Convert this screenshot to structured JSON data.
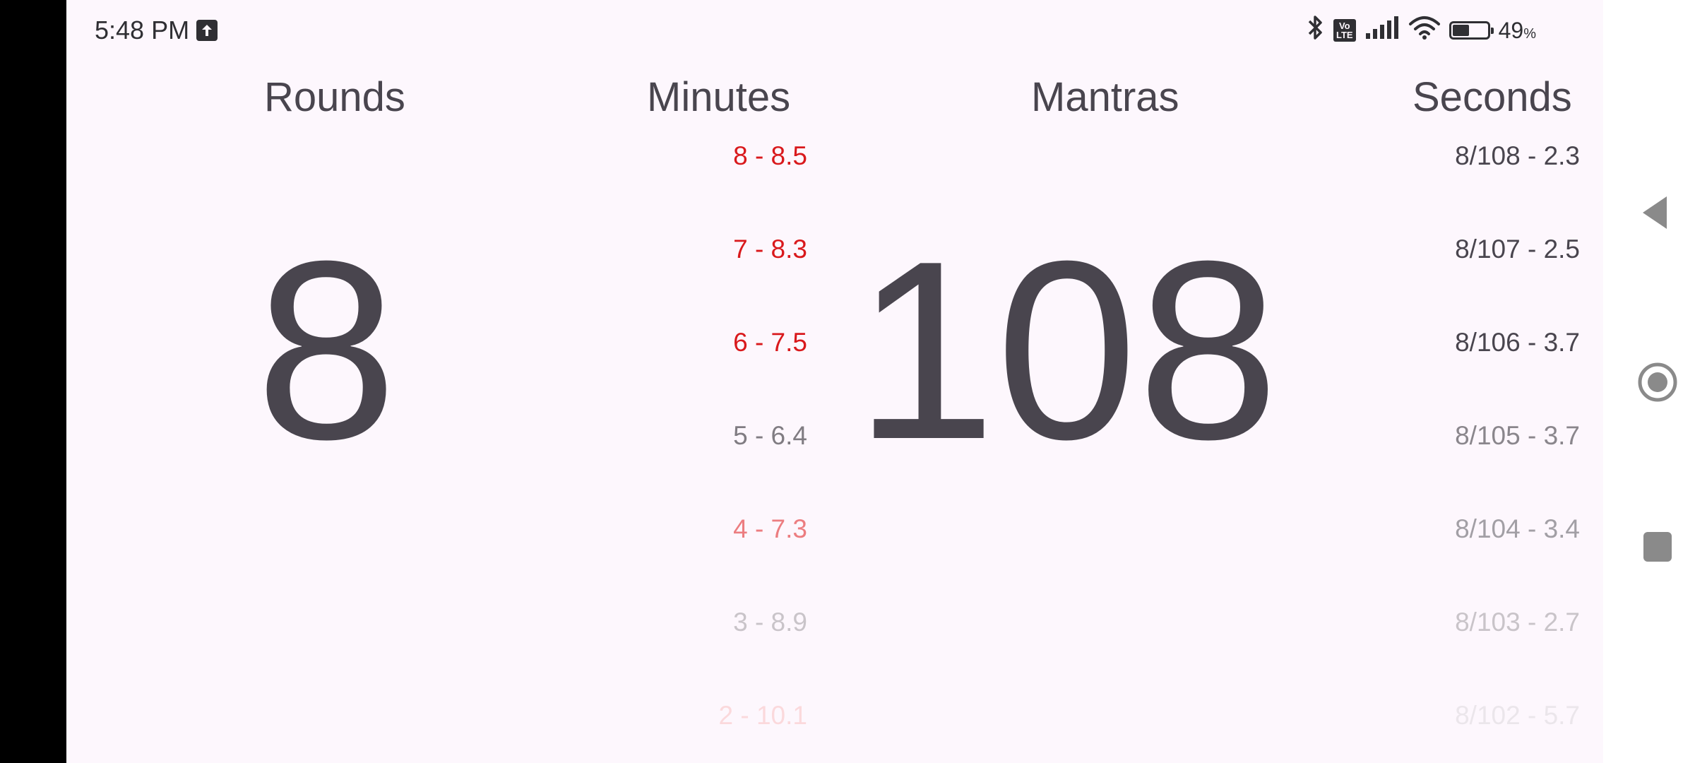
{
  "status_bar": {
    "time": "5:48 PM",
    "battery_level": 0.49,
    "battery_text": "49",
    "battery_unit": "%",
    "volte_top": "Vo",
    "volte_bottom": "LTE"
  },
  "headers": {
    "rounds": "Rounds",
    "minutes": "Minutes",
    "mantras": "Mantras",
    "seconds": "Seconds"
  },
  "counters": {
    "rounds": "8",
    "mantras": "108"
  },
  "minutes_list": [
    {
      "text": "8 - 8.5",
      "color": "#d9191c"
    },
    {
      "text": "7 - 8.3",
      "color": "#d9191c"
    },
    {
      "text": "6 - 7.5",
      "color": "#d9191c"
    },
    {
      "text": "5 - 6.4",
      "color": "#807c82"
    },
    {
      "text": "4 - 7.3",
      "color": "#ec7d80"
    },
    {
      "text": "3 - 8.9",
      "color": "#c9c4c9"
    },
    {
      "text": "2 - 10.1",
      "color": "#fbd9dc"
    }
  ],
  "seconds_list": [
    {
      "text": "8/108 - 2.3",
      "color": "#49454e"
    },
    {
      "text": "8/107 - 2.5",
      "color": "#49454e"
    },
    {
      "text": "8/106 - 3.7",
      "color": "#49454e"
    },
    {
      "text": "8/105 - 3.7",
      "color": "#8a868c"
    },
    {
      "text": "8/104 - 3.4",
      "color": "#a29fa5"
    },
    {
      "text": "8/103 - 2.7",
      "color": "#c9c4c9"
    },
    {
      "text": "8/102 - 5.7",
      "color": "#ebe6eb"
    }
  ],
  "colors": {
    "background": "#fdf7fd",
    "text": "#49454e",
    "accent_red": "#d9191c",
    "nav_icon": "#8a8a8a"
  },
  "nav": {
    "back": "back-icon",
    "home": "home-icon",
    "recents": "recents-icon"
  }
}
